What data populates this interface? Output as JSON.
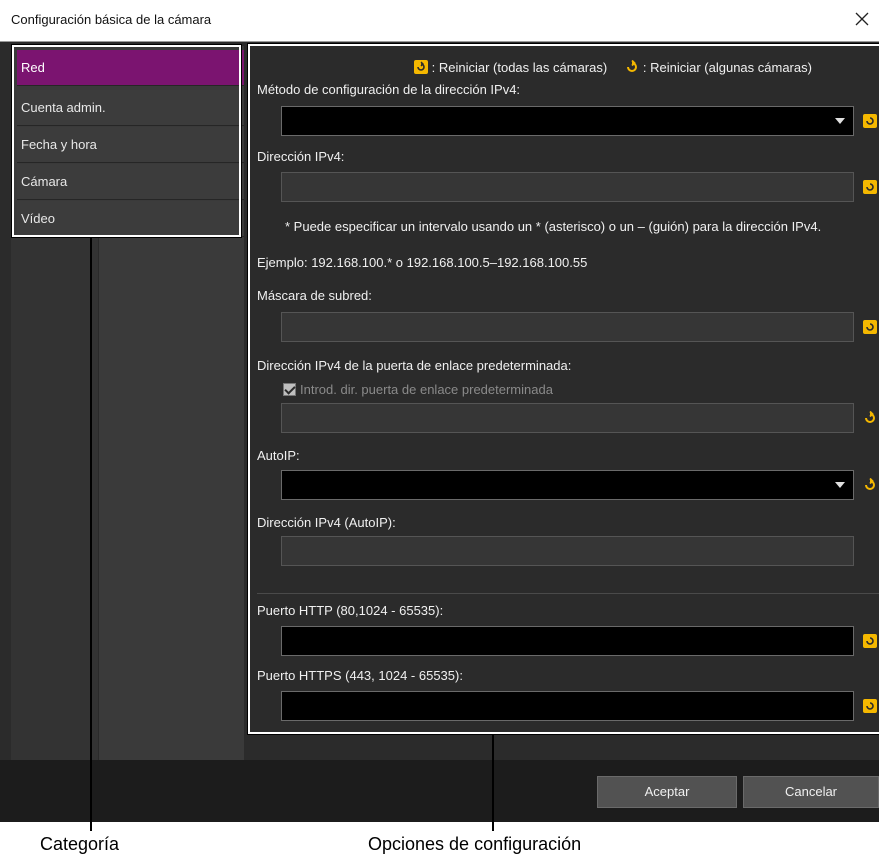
{
  "window": {
    "title": "Configuración básica de la cámara"
  },
  "legend": {
    "all_reset_label": ": Reiniciar (todas las cámaras)",
    "some_reset_label": ": Reiniciar (algunas cámaras)"
  },
  "categories": [
    {
      "label": "Red",
      "active": true
    },
    {
      "label": "Cuenta admin."
    },
    {
      "label": "Fecha y hora"
    },
    {
      "label": "Cámara"
    },
    {
      "label": "Vídeo"
    }
  ],
  "settings": {
    "ipv4_method_label": "Método de configuración de la dirección IPv4:",
    "ipv4_address_label": "Dirección IPv4:",
    "ipv4_note_line1": "* Puede especificar un intervalo usando un * (asterisco) o un – (guión) para la dirección IPv4.",
    "ipv4_note_line2": "Ejemplo: 192.168.100.* o 192.168.100.5–192.168.100.55",
    "subnet_label": "Máscara de subred:",
    "gateway_label": "Dirección IPv4 de la puerta de enlace predeterminada:",
    "gateway_checkbox_label": "Introd. dir. puerta de enlace predeterminada",
    "autoip_label": "AutoIP:",
    "autoip_address_label": "Dirección IPv4 (AutoIP):",
    "http_port_label": "Puerto HTTP (80,1024 - 65535):",
    "https_port_label": "Puerto HTTPS (443, 1024 - 65535):"
  },
  "buttons": {
    "ok": "Aceptar",
    "cancel": "Cancelar"
  },
  "callouts": {
    "category": "Categoría",
    "options": "Opciones de configuración"
  },
  "colors": {
    "accent": "#7b1470",
    "reset_icon": "#f5b800",
    "panel_bg": "#2b2b2b"
  }
}
